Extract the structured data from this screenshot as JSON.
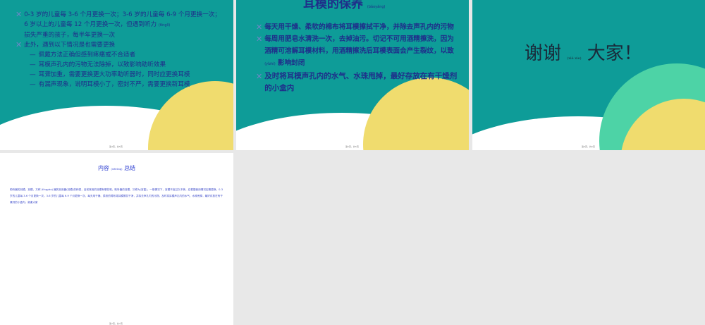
{
  "slide1": {
    "bullet1": "0-3 岁的儿童每 3-6 个月更换一次；3-6 岁的儿童每 6-9 个月更换一次；6 岁以上的儿童每 12 个月更换一次，但遇到听力",
    "bullet1_pinyin": "(tīnglì)",
    "bullet1_tail": "损失严重的孩子，每半年更换一次",
    "bullet2": "此外，遇到以下情况是也需要更换",
    "subs": [
      "佩戴方法正确但感到疼痛或不合适者",
      "耳模声孔内的污物无法除掉，以致影响助听效果",
      "耳聋加重，需要更换更大功率助听器时，同时应更换耳模",
      "有漏声现象，说明耳模小了，密封不严，需要更换新耳模"
    ],
    "page": "第4页，共5页"
  },
  "slide2": {
    "title": "耳模的保养",
    "title_pinyin": "(bǎoyǎng)",
    "bullet1": "每天用干燥、柔软的棉布将耳模擦拭干净，并除去声孔内的污物",
    "bullet2a": "每周用肥皂水清洗一次，去掉油污。切记不可用酒精擦洗，因为酒精可溶解耳模材料，用酒精擦洗后耳模表面会产生裂纹，以致",
    "bullet2_pinyin": "(yǐzhì)",
    "bullet2b": "影响封闭",
    "bullet3": "及时将耳模声孔内的水气、水珠甩掉，最好存放在有干燥剂的小盒内",
    "page": "第5页，共5页"
  },
  "slide3": {
    "thanks_left": "谢谢",
    "thanks_pinyin": "(xiè xie)",
    "thanks_right": "大家！",
    "page": "第6页，共6页"
  },
  "slide4": {
    "title": "内容",
    "title_pinyin": "(nèiróng)",
    "title_tail": "总结",
    "summary": "助听器的耳模。耳模，又称 (tīngyào) 器的耳用器(耳模)的种类，目前常用的耳模有哪些呢。助听器的耳模，又称为(耳塞)。一般情况下，耳模不宜过久不换，应根据使用情况定期更换。0-3 岁的儿童每 3-6 个月更换一次。3-6 岁的儿童每 6-9 个月更换一次。每天用干燥、柔软的棉布将耳模擦拭干净，并除去声孔内的污物。及时将耳模声孔内的水气、水珠甩掉，最好存放在有干燥剂的小盒内。谢谢大家",
    "page": "第7页，共7页"
  }
}
